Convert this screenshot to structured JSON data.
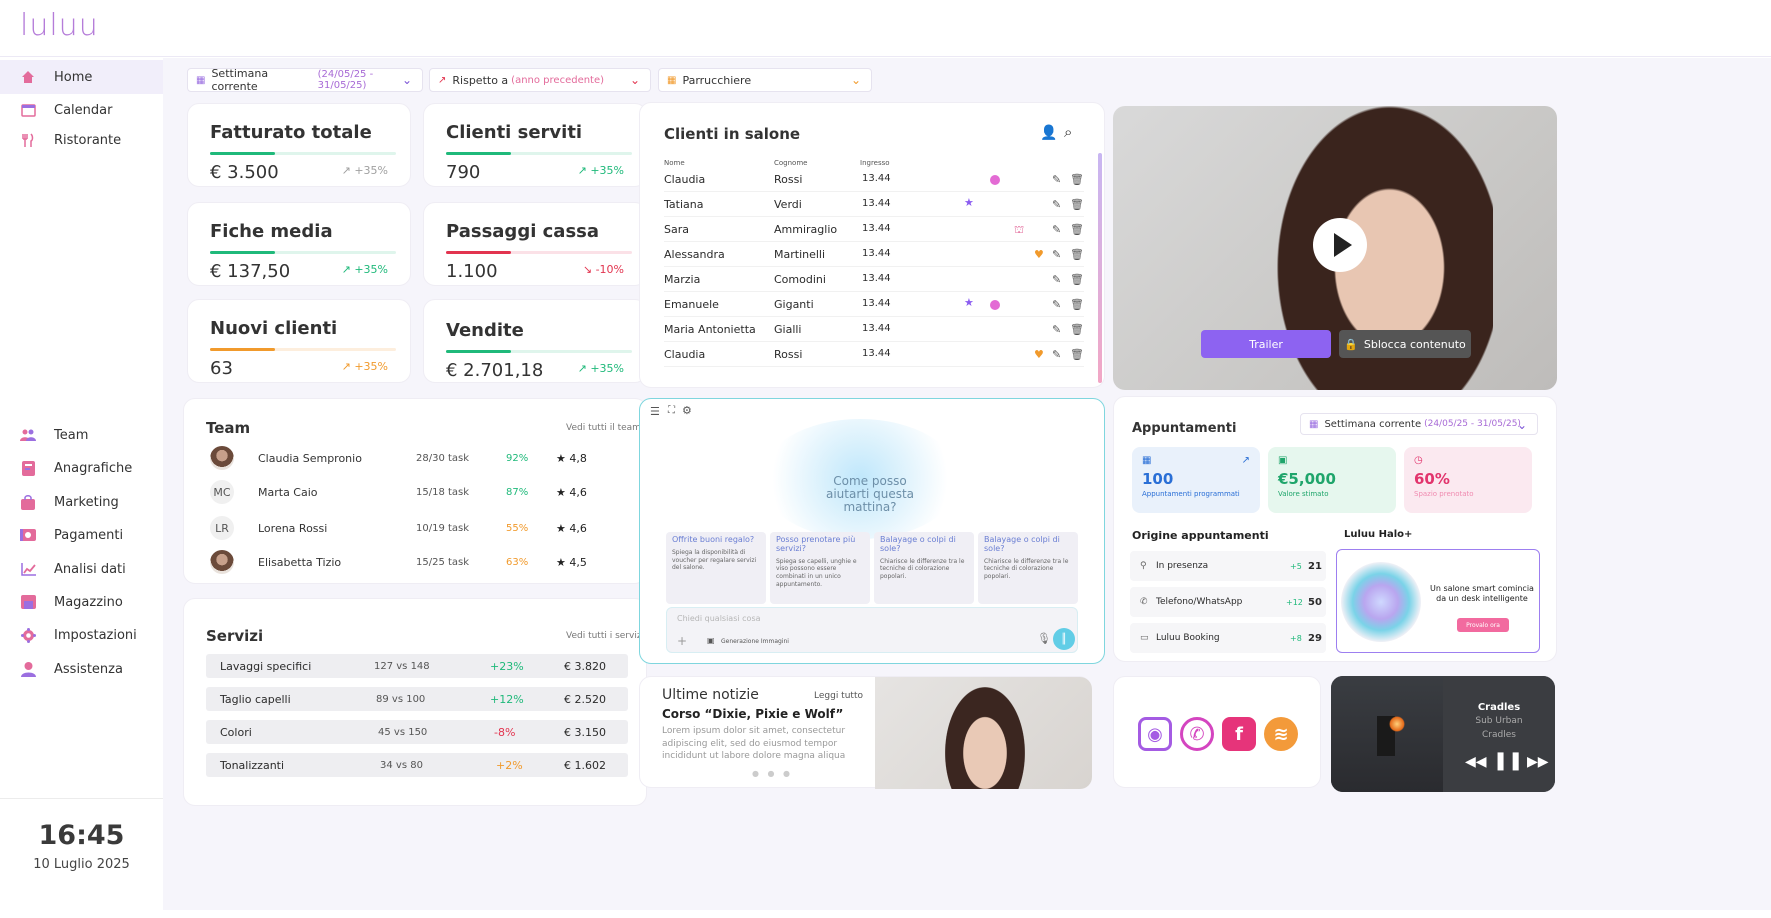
{
  "app": {
    "logo": "luluu"
  },
  "sidebar": {
    "items": [
      {
        "label": "Home",
        "icon": "home-icon"
      },
      {
        "label": "Calendar",
        "icon": "calendar-icon"
      },
      {
        "label": "Ristorante",
        "icon": "cutlery-icon"
      },
      {
        "label": "Team",
        "icon": "team-icon"
      },
      {
        "label": "Anagrafiche",
        "icon": "contacts-icon"
      },
      {
        "label": "Marketing",
        "icon": "bag-icon"
      },
      {
        "label": "Pagamenti",
        "icon": "payment-icon"
      },
      {
        "label": "Analisi dati",
        "icon": "chart-icon"
      },
      {
        "label": "Magazzino",
        "icon": "warehouse-icon"
      },
      {
        "label": "Impostazioni",
        "icon": "gear-icon"
      },
      {
        "label": "Assistenza",
        "icon": "support-icon"
      }
    ],
    "clock": {
      "time": "16:45",
      "date": "10 Luglio 2025"
    }
  },
  "filters": {
    "period": {
      "label": "Settimana corrente",
      "range": "(24/05/25 - 31/05/25)"
    },
    "compare": {
      "label": "Rispetto a",
      "range": "(anno precedente)"
    },
    "category": {
      "label": "Parrucchiere"
    }
  },
  "kpis": [
    {
      "title": "Fatturato totale",
      "value": "€ 3.500",
      "delta": "+35%",
      "trend": "up",
      "progress": 0.35
    },
    {
      "title": "Clienti serviti",
      "value": "790",
      "delta": "+35%",
      "trend": "up",
      "progress": 0.35
    },
    {
      "title": "Fiche media",
      "value": "€ 137,50",
      "delta": "+35%",
      "trend": "up",
      "progress": 0.35
    },
    {
      "title": "Passaggi cassa",
      "value": "1.100",
      "delta": "-10%",
      "trend": "down",
      "progress": 0.35
    },
    {
      "title": "Nuovi clienti",
      "value": "63",
      "delta": "+35%",
      "trend": "warn",
      "progress": 0.35
    },
    {
      "title": "Vendite",
      "value": "€ 2.701,18",
      "delta": "+35%",
      "trend": "up",
      "progress": 0.35
    }
  ],
  "team": {
    "title": "Team",
    "link": "Vedi tutti il team",
    "members": [
      {
        "initials": "",
        "name": "Claudia Sempronio",
        "tasks": "28/30 task",
        "percent": "92%",
        "percent_color": "#1fb97a",
        "rating": "4,8"
      },
      {
        "initials": "MC",
        "name": "Marta Caio",
        "tasks": "15/18 task",
        "percent": "87%",
        "percent_color": "#1fb97a",
        "rating": "4,6"
      },
      {
        "initials": "LR",
        "name": "Lorena Rossi",
        "tasks": "10/19 task",
        "percent": "55%",
        "percent_color": "#f19a2c",
        "rating": "4,6"
      },
      {
        "initials": "",
        "name": "Elisabetta Tizio",
        "tasks": "15/25 task",
        "percent": "63%",
        "percent_color": "#f19a2c",
        "rating": "4,5"
      }
    ]
  },
  "services": {
    "title": "Servizi",
    "link": "Vedi tutti i servizi",
    "rows": [
      {
        "name": "Lavaggi specifici",
        "compare": "127 vs 148",
        "delta": "+23%",
        "delta_color": "#1fb97a",
        "amount": "€ 3.820"
      },
      {
        "name": "Taglio capelli",
        "compare": "89 vs 100",
        "delta": "+12%",
        "delta_color": "#1fb97a",
        "amount": "€ 2.520"
      },
      {
        "name": "Colori",
        "compare": "45 vs 150",
        "delta": "-8%",
        "delta_color": "#e2344f",
        "amount": "€ 3.150"
      },
      {
        "name": "Tonalizzanti",
        "compare": "34 vs 80",
        "delta": "+2%",
        "delta_color": "#f19a2c",
        "amount": "€ 1.602"
      }
    ]
  },
  "clients": {
    "title": "Clienti in salone",
    "headers": {
      "first": "Nome",
      "last": "Cognome",
      "time": "Ingresso"
    },
    "rows": [
      {
        "first": "Claudia",
        "last": "Rossi",
        "time": "13.44",
        "badges": [
          "pink-dot"
        ]
      },
      {
        "first": "Tatiana",
        "last": "Verdi",
        "time": "13.44",
        "badges": [
          "star"
        ]
      },
      {
        "first": "Sara",
        "last": "Ammiraglio",
        "time": "13.44",
        "badges": [
          "cake"
        ]
      },
      {
        "first": "Alessandra",
        "last": "Martinelli",
        "time": "13.44",
        "badges": [
          "heart"
        ]
      },
      {
        "first": "Marzia",
        "last": "Comodini",
        "time": "13.44",
        "badges": []
      },
      {
        "first": "Emanuele",
        "last": "Giganti",
        "time": "13.44",
        "badges": [
          "star",
          "pink-dot"
        ]
      },
      {
        "first": "Maria Antonietta",
        "last": "Gialli",
        "time": "13.44",
        "badges": []
      },
      {
        "first": "Claudia",
        "last": "Rossi",
        "time": "13.44",
        "badges": [
          "heart"
        ]
      }
    ]
  },
  "ai": {
    "prompt": "Come posso aiutarti questa mattina?",
    "suggestions": [
      {
        "q": "Offrite buoni regalo?",
        "a": "Spiega la disponibilità di voucher per regalare servizi del salone."
      },
      {
        "q": "Posso prenotare più servizi?",
        "a": "Spiega se capelli, unghie e viso possono essere combinati in un unico appuntamento."
      },
      {
        "q": "Balayage o colpi di sole?",
        "a": "Chiarisce le differenze tra le tecniche di colorazione popolari."
      },
      {
        "q": "Balayage o colpi di sole?",
        "a": "Chiarisce le differenze tra le tecniche di colorazione popolari."
      }
    ],
    "input_placeholder": "Chiedi qualsiasi cosa",
    "image_gen": "Generazione Immagini"
  },
  "news": {
    "title": "Ultime notizie",
    "link": "Leggi tutto",
    "headline": "Corso “Dixie, Pixie e Wolf”",
    "body": "Lorem ipsum dolor sit amet, consectetur adipiscing elit, sed do eiusmod tempor incididunt ut labore dolore magna aliqua"
  },
  "video": {
    "trailer": "Trailer",
    "unlock": "Sblocca contenuto"
  },
  "appointments": {
    "title": "Appuntamenti",
    "period": "Settimana corrente",
    "range": "(24/05/25 - 31/05/25)",
    "boxes": [
      {
        "value": "100",
        "label": "Appuntamenti programmati",
        "bg": "#e9f1fb",
        "color": "#2a6fd6"
      },
      {
        "value": "€5,000",
        "label": "Valore stimato",
        "bg": "#e6f7ee",
        "color": "#1fa56b"
      },
      {
        "value": "60%",
        "label": "Spazio prenotato",
        "bg": "#fbe9f0",
        "color": "#e2346d"
      }
    ],
    "origin_title": "Origine appuntamenti",
    "origins": [
      {
        "label": "In presenza",
        "delta": "+5",
        "value": "21"
      },
      {
        "label": "Telefono/WhatsApp",
        "delta": "+12",
        "value": "50"
      },
      {
        "label": "Luluu Booking",
        "delta": "+8",
        "value": "29"
      }
    ],
    "halo": {
      "title": "Luluu Halo+",
      "text": "Un salone smart comincia da un desk intelligente",
      "cta": "Provalo ora"
    }
  },
  "social": {
    "icons": [
      "instagram-icon",
      "whatsapp-icon",
      "facebook-icon",
      "spotify-icon"
    ]
  },
  "music": {
    "title": "Cradles",
    "artist": "Sub Urban",
    "album": "Cradles"
  }
}
